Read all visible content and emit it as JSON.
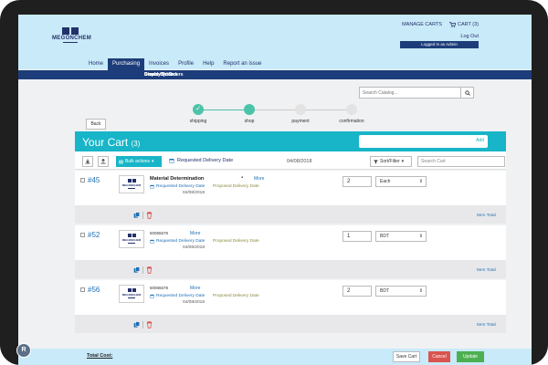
{
  "header": {
    "brand": "MEGONCHEM",
    "manage_carts": "MANAGE CARTS",
    "cart_label": "CART (3)",
    "logout": "Log Out",
    "logged_in": "Logged In as Admin"
  },
  "nav": {
    "tabs": [
      {
        "label": "Home"
      },
      {
        "label": "Purchasing",
        "active": true
      },
      {
        "label": "Invoices"
      },
      {
        "label": "Profile"
      },
      {
        "label": "Help"
      },
      {
        "label": "Report an issue"
      }
    ],
    "subnav": [
      {
        "label": "Search for Orders"
      },
      {
        "label": "Create Order"
      },
      {
        "label": "Display Quotes"
      }
    ]
  },
  "search": {
    "placeholder": "Search Catalog..."
  },
  "back_label": "Back",
  "steps": [
    {
      "label": "shipping",
      "state": "done"
    },
    {
      "label": "shop",
      "state": "current"
    },
    {
      "label": "payment",
      "state": "pending"
    },
    {
      "label": "confirmation",
      "state": "pending"
    }
  ],
  "cart": {
    "title": "Your Cart",
    "count": "(3)",
    "add_label": "Add"
  },
  "toolbar": {
    "bulk_actions": "Bulk actions",
    "requested_delivery": "Requested Delivery Date",
    "date": "04/08/2018",
    "sort_filter": "Sort/Filter",
    "search_cart_placeholder": "Search Cart"
  },
  "items": [
    {
      "number": "#45",
      "name": "Material Determination",
      "sku": "",
      "more": "More",
      "requested_delivery": "Requested Delivery Date",
      "delivery_date": "04/08/2018",
      "proposed_delivery": "Proposed Delivery Date",
      "qty": "2",
      "unit": "Each",
      "item_total": "Item Total"
    },
    {
      "number": "#52",
      "name": "",
      "sku": "50065578",
      "more": "More",
      "requested_delivery": "Requested Delivery Date",
      "delivery_date": "04/08/2018",
      "proposed_delivery": "Proposed Delivery Date",
      "qty": "1",
      "unit": "BDT",
      "item_total": "Item Total"
    },
    {
      "number": "#56",
      "name": "",
      "sku": "50065578",
      "more": "More",
      "requested_delivery": "Requested Delivery Date",
      "delivery_date": "04/08/2018",
      "proposed_delivery": "Proposed Delivery Date",
      "qty": "2",
      "unit": "BDT",
      "item_total": "Item Total"
    }
  ],
  "footer": {
    "total_cost": "Total Cost:",
    "save_cart": "Save Cart",
    "cancel": "Cancel",
    "update": "Update"
  },
  "badge": "R",
  "colors": {
    "brand_navy": "#1d3d7a",
    "header_bg": "#c9eaf8",
    "accent_teal": "#17b5c7",
    "step_green": "#4cc3a8",
    "cancel_red": "#d9534f",
    "update_green": "#4cb050",
    "link_blue": "#1f6fb5"
  }
}
